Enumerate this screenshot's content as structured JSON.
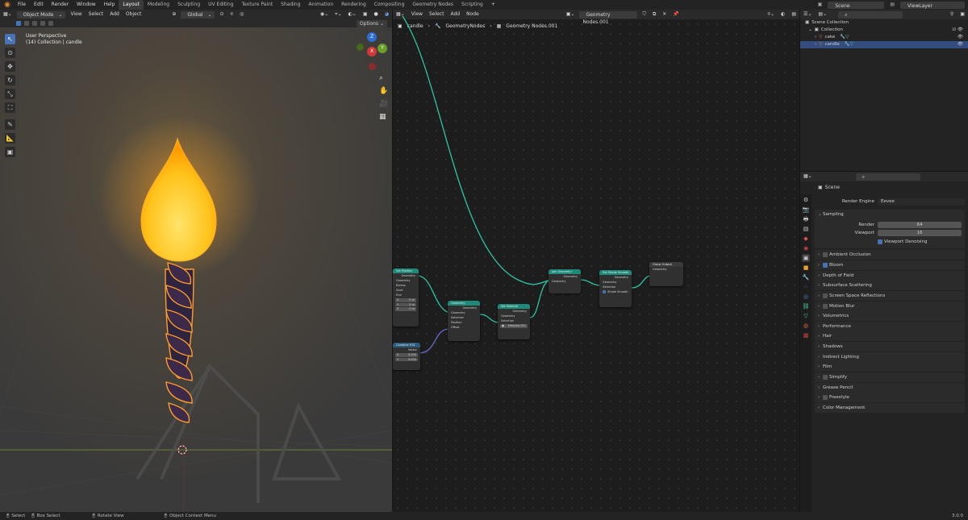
{
  "topbar": {
    "menus": [
      "File",
      "Edit",
      "Render",
      "Window",
      "Help"
    ],
    "workspaces": [
      "Layout",
      "Modeling",
      "Sculpting",
      "UV Editing",
      "Texture Paint",
      "Shading",
      "Animation",
      "Rendering",
      "Compositing",
      "Geometry Nodes",
      "Scripting"
    ],
    "scene": "Scene",
    "viewlayer": "ViewLayer"
  },
  "viewport": {
    "mode": "Object Mode",
    "menus": [
      "View",
      "Select",
      "Add",
      "Object"
    ],
    "orientation": "Global",
    "options": "Options",
    "title": "User Perspective",
    "subtitle": "(14) Collection | candle",
    "gizmo": {
      "z": "Z",
      "y": "Y",
      "x": "X"
    }
  },
  "node_editor": {
    "menus": [
      "View",
      "Select",
      "Add",
      "Node"
    ],
    "tree_name": "Geometry Nodes.001",
    "breadcrumb": [
      "candle",
      "GeometryNodes",
      "Geometry Nodes.001"
    ],
    "nodes": {
      "spiral": {
        "title": "Set Position",
        "out": "Geometry",
        "rows": [
          "Geometry",
          "Radius",
          "Start",
          "End"
        ],
        "fields": [
          [
            "X",
            "0 m"
          ],
          [
            "Y",
            "0 m"
          ],
          [
            "Z",
            "0 m"
          ]
        ]
      },
      "mesh": {
        "title": "Geometry",
        "out": "Geometry",
        "rows": [
          "Geometry",
          "Selection",
          "Position",
          "Offset"
        ]
      },
      "setmat": {
        "title": "Set Material",
        "out": "Geometry",
        "rows": [
          "Geometry",
          "Selection"
        ],
        "material": "Material.001"
      },
      "join": {
        "title": "Join Geometry",
        "out": "Geometry",
        "rows": [
          "Geometry"
        ]
      },
      "smooth": {
        "title": "Set Shade Smooth",
        "out": "Geometry",
        "rows": [
          "Geometry",
          "Selection",
          "Shade Smooth"
        ]
      },
      "output": {
        "title": "Group Output",
        "rows": [
          "Geometry"
        ]
      },
      "vector": {
        "title": "Combine XYZ",
        "out": "Vector",
        "rows": [
          "0.000",
          "0.000"
        ]
      }
    }
  },
  "outliner": {
    "root": "Scene Collection",
    "collection": "Collection",
    "items": [
      "cake",
      "candle"
    ]
  },
  "properties": {
    "crumb": "Scene",
    "render_engine_label": "Render Engine",
    "render_engine": "Eevee",
    "sampling": "Sampling",
    "render_label": "Render",
    "render_val": "64",
    "viewport_label": "Viewport",
    "viewport_val": "16",
    "denoise": "Viewport Denoising",
    "panels": [
      "Ambient Occlusion",
      "Bloom",
      "Depth of Field",
      "Subsurface Scattering",
      "Screen Space Reflections",
      "Motion Blur",
      "Volumetrics",
      "Performance",
      "Hair",
      "Shadows",
      "Indirect Lighting",
      "Film",
      "Simplify",
      "Grease Pencil",
      "Freestyle",
      "Color Management"
    ]
  },
  "status": {
    "select": "Select",
    "box": "Box Select",
    "rotate": "Rotate View",
    "context": "Object Context Menu",
    "version": "3.0.0"
  }
}
